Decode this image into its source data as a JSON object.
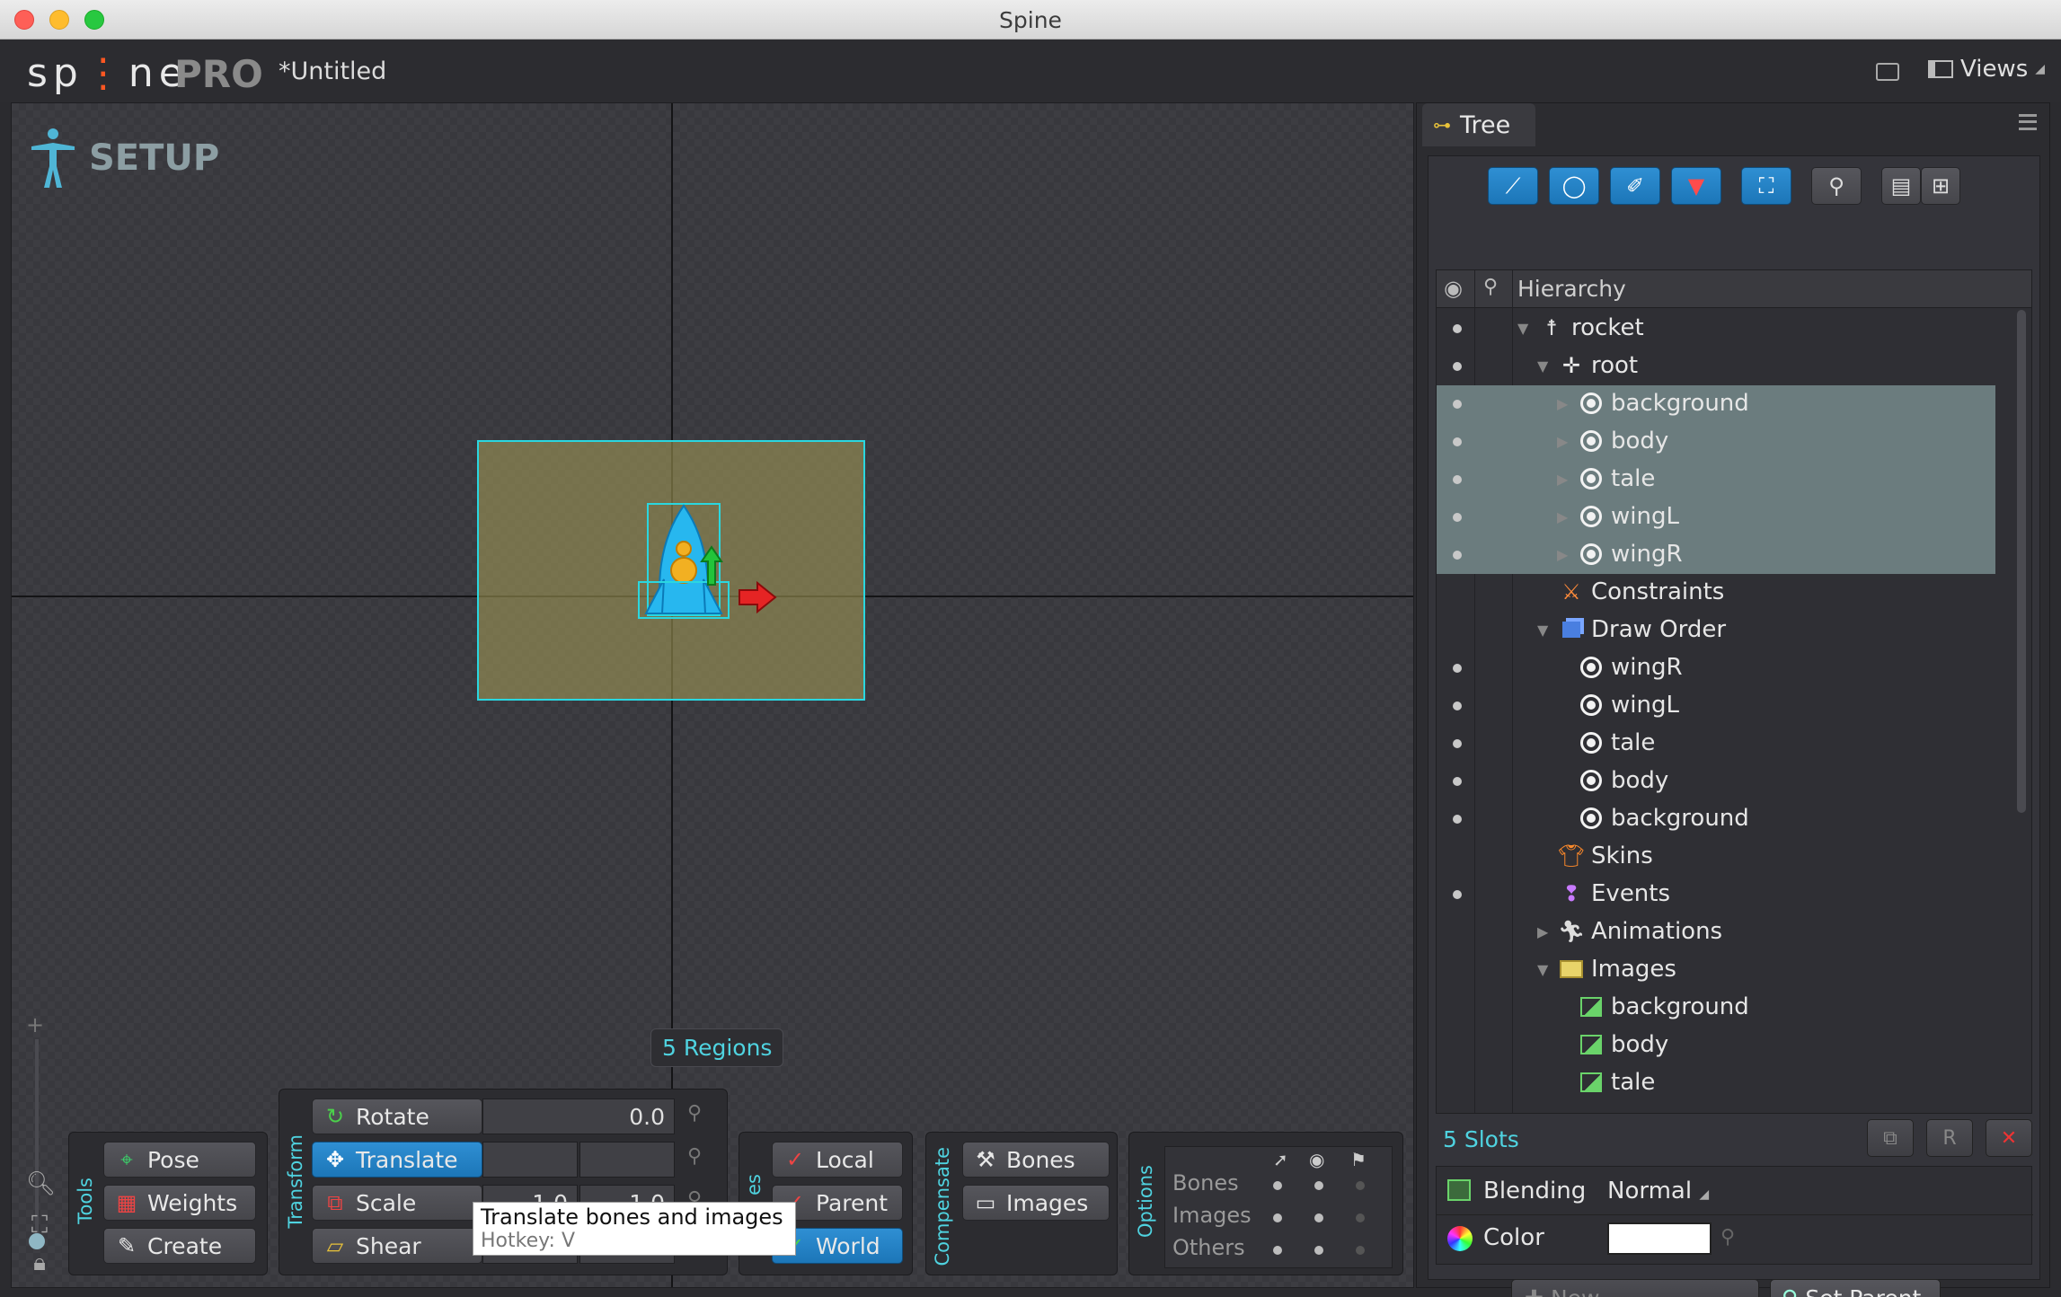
{
  "window": {
    "title": "Spine"
  },
  "app": {
    "logo": "sp ne",
    "edition": "PRO",
    "document_title": "*Untitled",
    "views_label": "Views"
  },
  "viewport": {
    "mode_label": "SETUP",
    "regions_badge": "5 Regions"
  },
  "tools": {
    "group_label": "Tools",
    "items": [
      {
        "label": "Pose",
        "icon": "pose-icon"
      },
      {
        "label": "Weights",
        "icon": "weights-icon"
      },
      {
        "label": "Create",
        "icon": "create-icon"
      }
    ]
  },
  "transform": {
    "group_label": "Transform",
    "rotate": {
      "label": "Rotate",
      "value": "0.0"
    },
    "translate": {
      "label": "Translate",
      "value_x": "",
      "value_y": ""
    },
    "scale": {
      "label": "Scale",
      "value_x": "1.0",
      "value_y": "1.0"
    },
    "shear": {
      "label": "Shear"
    },
    "active": "Translate"
  },
  "axes": {
    "group_label": "es",
    "items": [
      "Local",
      "Parent",
      "World"
    ],
    "active": "World"
  },
  "compensate": {
    "group_label": "Compensate",
    "items": [
      "Bones",
      "Images"
    ]
  },
  "options": {
    "group_label": "Options",
    "rows": [
      "Bones",
      "Images",
      "Others"
    ]
  },
  "tooltip": {
    "title": "Translate bones and images",
    "hotkey": "Hotkey: V"
  },
  "tree": {
    "tab_label": "Tree",
    "header_label": "Hierarchy",
    "rows": [
      {
        "label": "rocket",
        "icon": "skeleton-icon",
        "indent": 0,
        "arrow": "down",
        "dot": true,
        "selected": false
      },
      {
        "label": "root",
        "icon": "bone-icon",
        "indent": 1,
        "arrow": "down",
        "dot": true,
        "selected": false
      },
      {
        "label": "background",
        "icon": "slot-icon",
        "indent": 2,
        "arrow": "right",
        "dot": true,
        "selected": true
      },
      {
        "label": "body",
        "icon": "slot-icon",
        "indent": 2,
        "arrow": "right",
        "dot": true,
        "selected": true
      },
      {
        "label": "tale",
        "icon": "slot-icon",
        "indent": 2,
        "arrow": "right",
        "dot": true,
        "selected": true
      },
      {
        "label": "wingL",
        "icon": "slot-icon",
        "indent": 2,
        "arrow": "right",
        "dot": true,
        "selected": true
      },
      {
        "label": "wingR",
        "icon": "slot-icon",
        "indent": 2,
        "arrow": "right",
        "dot": true,
        "selected": true
      },
      {
        "label": "Constraints",
        "icon": "constraints-icon",
        "indent": 1,
        "arrow": "",
        "dot": false,
        "selected": false
      },
      {
        "label": "Draw Order",
        "icon": "draw-order-icon",
        "indent": 1,
        "arrow": "down",
        "dot": false,
        "selected": false
      },
      {
        "label": "wingR",
        "icon": "slot-icon",
        "indent": 2,
        "arrow": "",
        "dot": true,
        "selected": false
      },
      {
        "label": "wingL",
        "icon": "slot-icon",
        "indent": 2,
        "arrow": "",
        "dot": true,
        "selected": false
      },
      {
        "label": "tale",
        "icon": "slot-icon",
        "indent": 2,
        "arrow": "",
        "dot": true,
        "selected": false
      },
      {
        "label": "body",
        "icon": "slot-icon",
        "indent": 2,
        "arrow": "",
        "dot": true,
        "selected": false
      },
      {
        "label": "background",
        "icon": "slot-icon",
        "indent": 2,
        "arrow": "",
        "dot": true,
        "selected": false
      },
      {
        "label": "Skins",
        "icon": "skins-icon",
        "indent": 1,
        "arrow": "",
        "dot": false,
        "selected": false
      },
      {
        "label": "Events",
        "icon": "events-icon",
        "indent": 1,
        "arrow": "",
        "dot": true,
        "selected": false
      },
      {
        "label": "Animations",
        "icon": "animations-icon",
        "indent": 1,
        "arrow": "right",
        "dot": false,
        "selected": false
      },
      {
        "label": "Images",
        "icon": "images-folder-icon",
        "indent": 1,
        "arrow": "down",
        "dot": false,
        "selected": false
      },
      {
        "label": "background",
        "icon": "image-icon",
        "indent": 2,
        "arrow": "",
        "dot": false,
        "selected": false
      },
      {
        "label": "body",
        "icon": "image-icon",
        "indent": 2,
        "arrow": "",
        "dot": false,
        "selected": false
      },
      {
        "label": "tale",
        "icon": "image-icon",
        "indent": 2,
        "arrow": "",
        "dot": false,
        "selected": false
      }
    ]
  },
  "slots": {
    "count_label": "5 Slots",
    "blending": {
      "label": "Blending",
      "value": "Normal"
    },
    "color": {
      "label": "Color",
      "value": "#ffffff"
    },
    "new_label": "New...",
    "set_parent_label": "Set Parent"
  },
  "colors": {
    "accent_blue": "#1c76b8",
    "cyan_label": "#4fd3e0",
    "selection_row": "#6b7c7e"
  }
}
